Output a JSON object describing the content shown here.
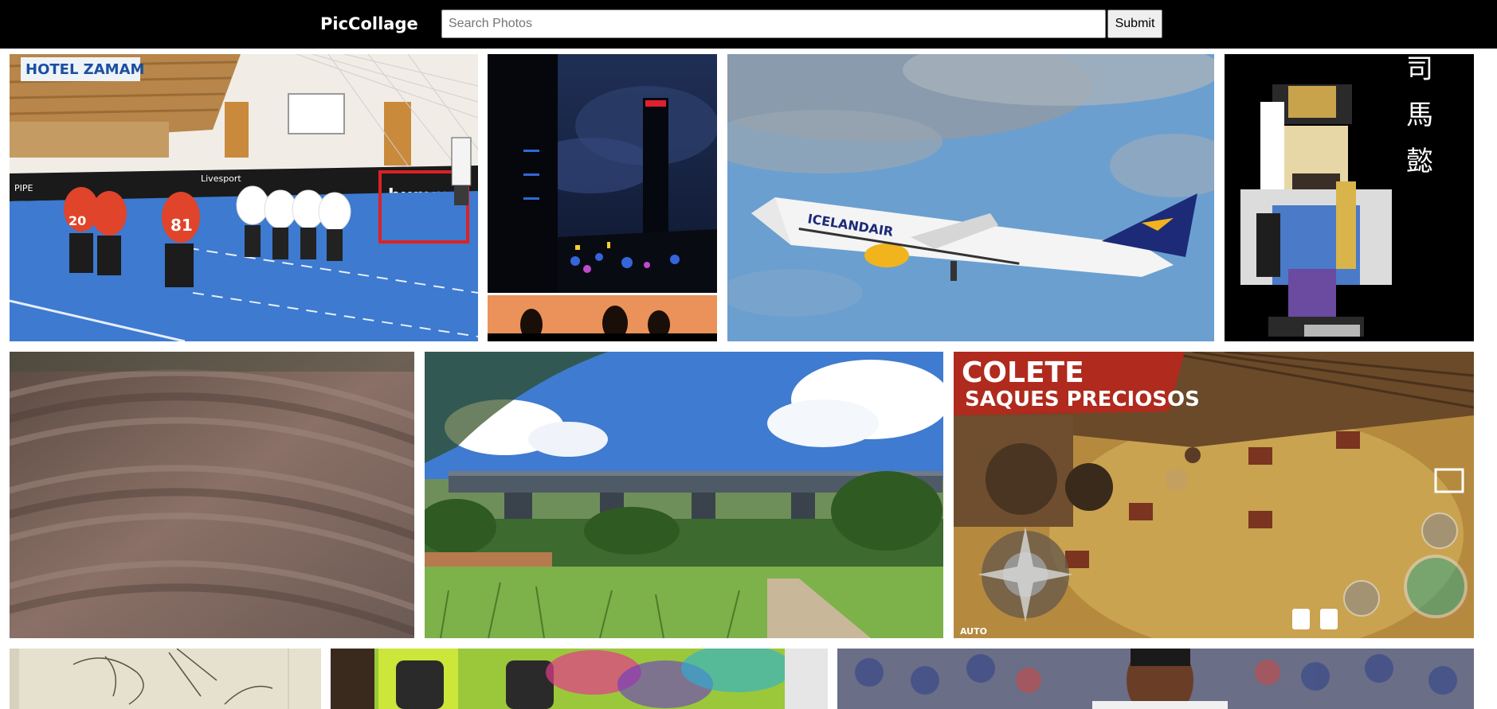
{
  "header": {
    "brand": "PicCollage",
    "search_placeholder": "Search Photos",
    "search_value": "",
    "submit_label": "Submit"
  },
  "photos": [
    {
      "name": "floorball-match",
      "signage": [
        "HOTEL ZAMAM",
        "Livesport",
        "hummel",
        "PIPE",
        "20",
        "81"
      ]
    },
    {
      "name": "city-skyline-night"
    },
    {
      "name": "icelandair-airplane",
      "livery": "ICELANDAIR"
    },
    {
      "name": "lego-bust-sima-yi",
      "glyphs": [
        "司",
        "馬",
        "懿"
      ]
    },
    {
      "name": "motion-blur-ground"
    },
    {
      "name": "railway-viaduct"
    },
    {
      "name": "game-screenshot",
      "caption_line1": "COLETE",
      "caption_line2": "SAQUES PRECIOSOS",
      "auto_label": "AUTO"
    },
    {
      "name": "bird-sketch"
    },
    {
      "name": "graffiti-van"
    },
    {
      "name": "basketball-player"
    }
  ]
}
